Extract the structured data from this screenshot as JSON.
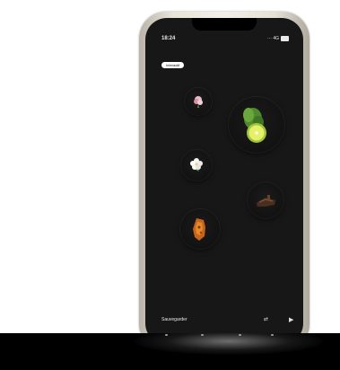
{
  "status_bar": {
    "time": "18:24",
    "signal": "··· 4G"
  },
  "pill": {
    "label": "Interactif"
  },
  "plates": [
    {
      "food": "flower-bud-icon"
    },
    {
      "food": "lime-with-leaves-icon"
    },
    {
      "food": "jasmine-flower-icon"
    },
    {
      "food": "chocolate-icon"
    },
    {
      "food": "caramel-crisp-icon"
    }
  ],
  "bottom_bar": {
    "save_label": "Sauvegarder",
    "shuffle_icon": "shuffle-icon",
    "play_icon": "play-icon"
  },
  "colors": {
    "screen": "#171717",
    "text": "#e8e8e8",
    "lime": "#c7e04a"
  }
}
